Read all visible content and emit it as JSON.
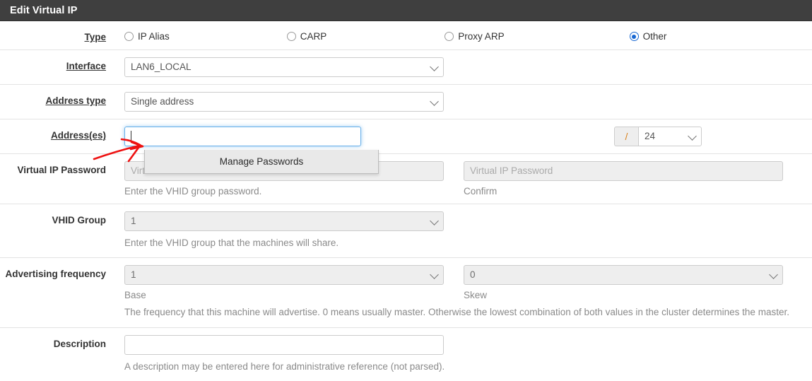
{
  "header": {
    "title": "Edit Virtual IP"
  },
  "type_row": {
    "label": "Type",
    "options": [
      {
        "label": "IP Alias",
        "checked": false
      },
      {
        "label": "CARP",
        "checked": false
      },
      {
        "label": "Proxy ARP",
        "checked": false
      },
      {
        "label": "Other",
        "checked": true
      }
    ]
  },
  "interface_row": {
    "label": "Interface",
    "value": "LAN6_LOCAL"
  },
  "address_type_row": {
    "label": "Address type",
    "value": "Single address"
  },
  "address_row": {
    "label": "Address(es)",
    "value": "",
    "placeholder": "",
    "slash": "/",
    "prefix_value": "24"
  },
  "autofill": {
    "item_label": "Manage Passwords"
  },
  "password_row": {
    "label": "Virtual IP Password",
    "password_placeholder": "Virtual IP Password",
    "password_help": "Enter the VHID group password.",
    "confirm_placeholder": "Virtual IP Password",
    "confirm_help": "Confirm"
  },
  "vhid_row": {
    "label": "VHID Group",
    "value": "1",
    "help": "Enter the VHID group that the machines will share."
  },
  "advertising_row": {
    "label": "Advertising frequency",
    "base_value": "1",
    "base_help": "Base",
    "skew_value": "0",
    "skew_help": "Skew",
    "help": "The frequency that this machine will advertise. 0 means usually master. Otherwise the lowest combination of both values in the cluster determines the master."
  },
  "description_row": {
    "label": "Description",
    "value": "",
    "help": "A description may be entered here for administrative reference (not parsed)."
  },
  "colors": {
    "header_bg": "#3f3f3f",
    "accent_radio": "#1767d2",
    "focus_border": "#66afe9",
    "slash_text": "#d9831f",
    "annotation": "#ee1111"
  }
}
